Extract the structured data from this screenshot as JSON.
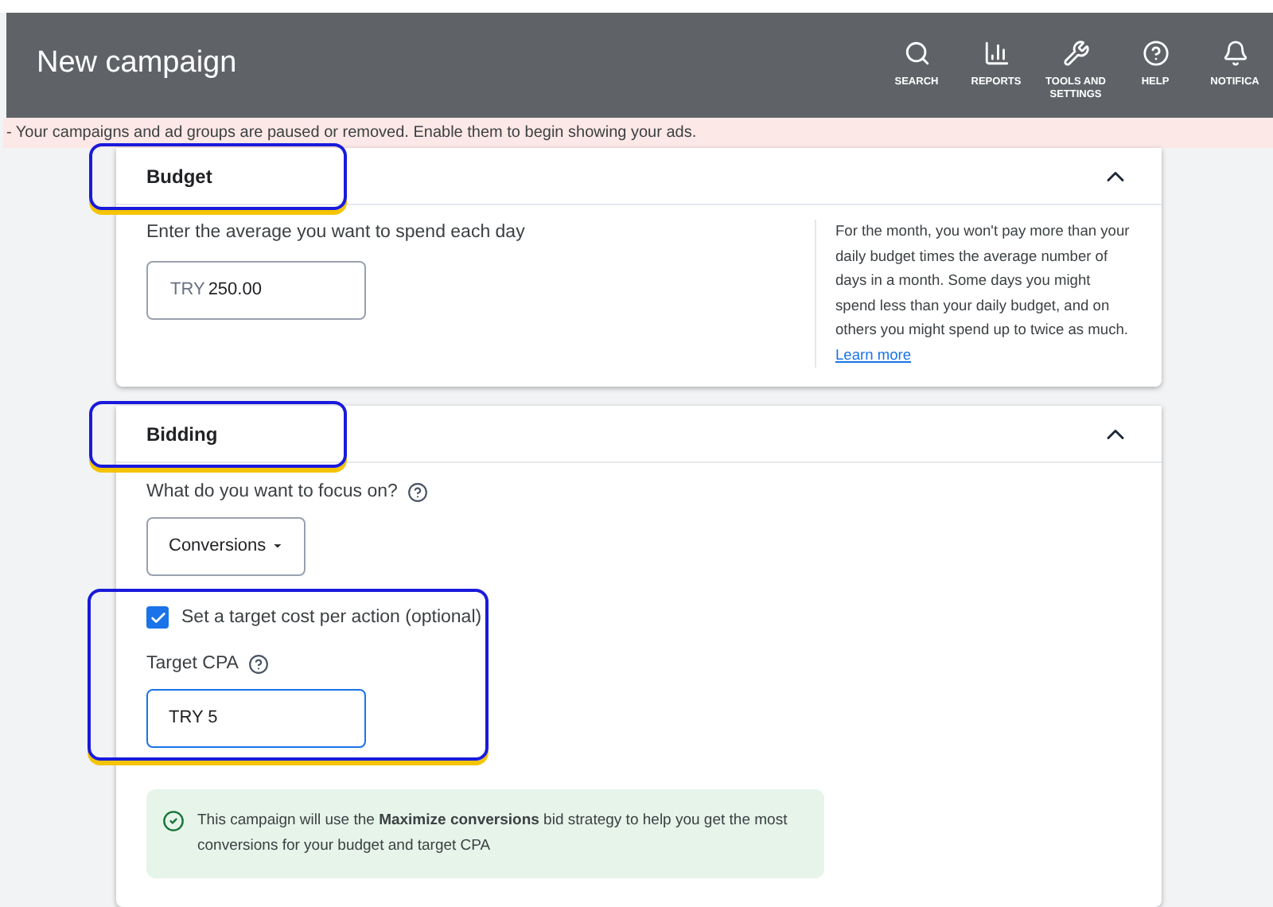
{
  "header": {
    "title": "New campaign",
    "actions": [
      {
        "kind": "search",
        "label": "SEARCH"
      },
      {
        "kind": "reports",
        "label": "REPORTS"
      },
      {
        "kind": "tools",
        "label": "TOOLS AND SETTINGS"
      },
      {
        "kind": "help",
        "label": "HELP"
      },
      {
        "kind": "bell",
        "label": "NOTIFICA"
      }
    ]
  },
  "banner": "- Your campaigns and ad groups are paused or removed. Enable them to begin showing your ads.",
  "budget": {
    "title": "Budget",
    "expanded": true,
    "highlighted": true,
    "prompt": "Enter the average you want to spend each day",
    "currency": "TRY",
    "value": "250.00",
    "help": "For the month, you won't pay more than your daily budget times the average number of days in a month. Some days you might spend less than your daily budget, and on others you might spend up to twice as much.",
    "link": "Learn more"
  },
  "bidding": {
    "title": "Bidding",
    "expanded": true,
    "highlighted": true,
    "focus_label": "What do you want to focus on?",
    "focus_value": "Conversions",
    "target_highlighted": true,
    "checkbox": {
      "label": "Set a target cost per action (optional)",
      "checked": true
    },
    "cpa_label": "Target CPA",
    "cpa_value": "TRY 5",
    "info": "This campaign will use the **Maximize conversions** bid strategy to help you get the most conversions for your budget and target CPA"
  }
}
